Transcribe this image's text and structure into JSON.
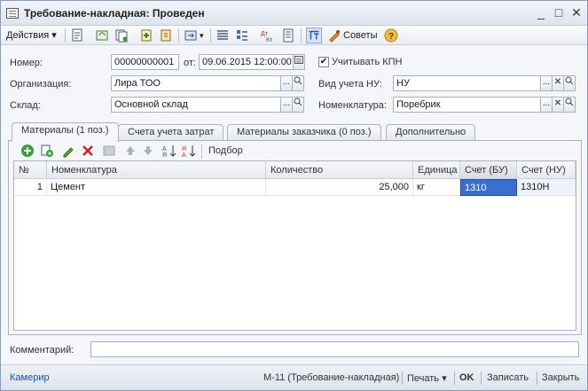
{
  "window": {
    "title": "Требование-накладная: Проведен",
    "minimize": "_",
    "maximize": "□",
    "close": "✕"
  },
  "toolbar": {
    "actions_label": "Действия",
    "advice_label": "Советы"
  },
  "form": {
    "number_label": "Номер:",
    "number_value": "00000000001",
    "date_label": "от:",
    "date_value": "09.06.2015 12:00:00",
    "kpn_label": "Учитывать КПН",
    "kpn_checked": true,
    "org_label": "Организация:",
    "org_value": "Лира ТОО",
    "tax_label": "Вид учета НУ:",
    "tax_value": "НУ",
    "warehouse_label": "Склад:",
    "warehouse_value": "Основной склад",
    "nomenclature_label": "Номенклатура:",
    "nomenclature_value": "Поребрик"
  },
  "tabs": [
    {
      "label": "Материалы (1 поз.)",
      "active": true
    },
    {
      "label": "Счета учета затрат",
      "active": false
    },
    {
      "label": "Материалы заказчика (0 поз.)",
      "active": false
    },
    {
      "label": "Дополнительно",
      "active": false
    }
  ],
  "grid_toolbar": {
    "selection_label": "Подбор"
  },
  "table": {
    "columns": [
      "№",
      "Номенклатура",
      "Количество",
      "Единица",
      "Счет (БУ)",
      "Счет (НУ)"
    ],
    "rows": [
      {
        "n": "1",
        "item": "Цемент",
        "qty": "25,000",
        "unit": "кг",
        "acc_bu": "1310",
        "acc_nu": "1310Н"
      }
    ]
  },
  "comment": {
    "label": "Комментарий:",
    "value": ""
  },
  "statusbar": {
    "cashier": "Камерир",
    "form_m11": "М-11 (Требование-накладная)",
    "print": "Печать",
    "ok": "OK",
    "save": "Записать",
    "close": "Закрыть"
  },
  "colors": {
    "selected_cell": "#3a6fd0",
    "accent": "#1f4fa0"
  }
}
